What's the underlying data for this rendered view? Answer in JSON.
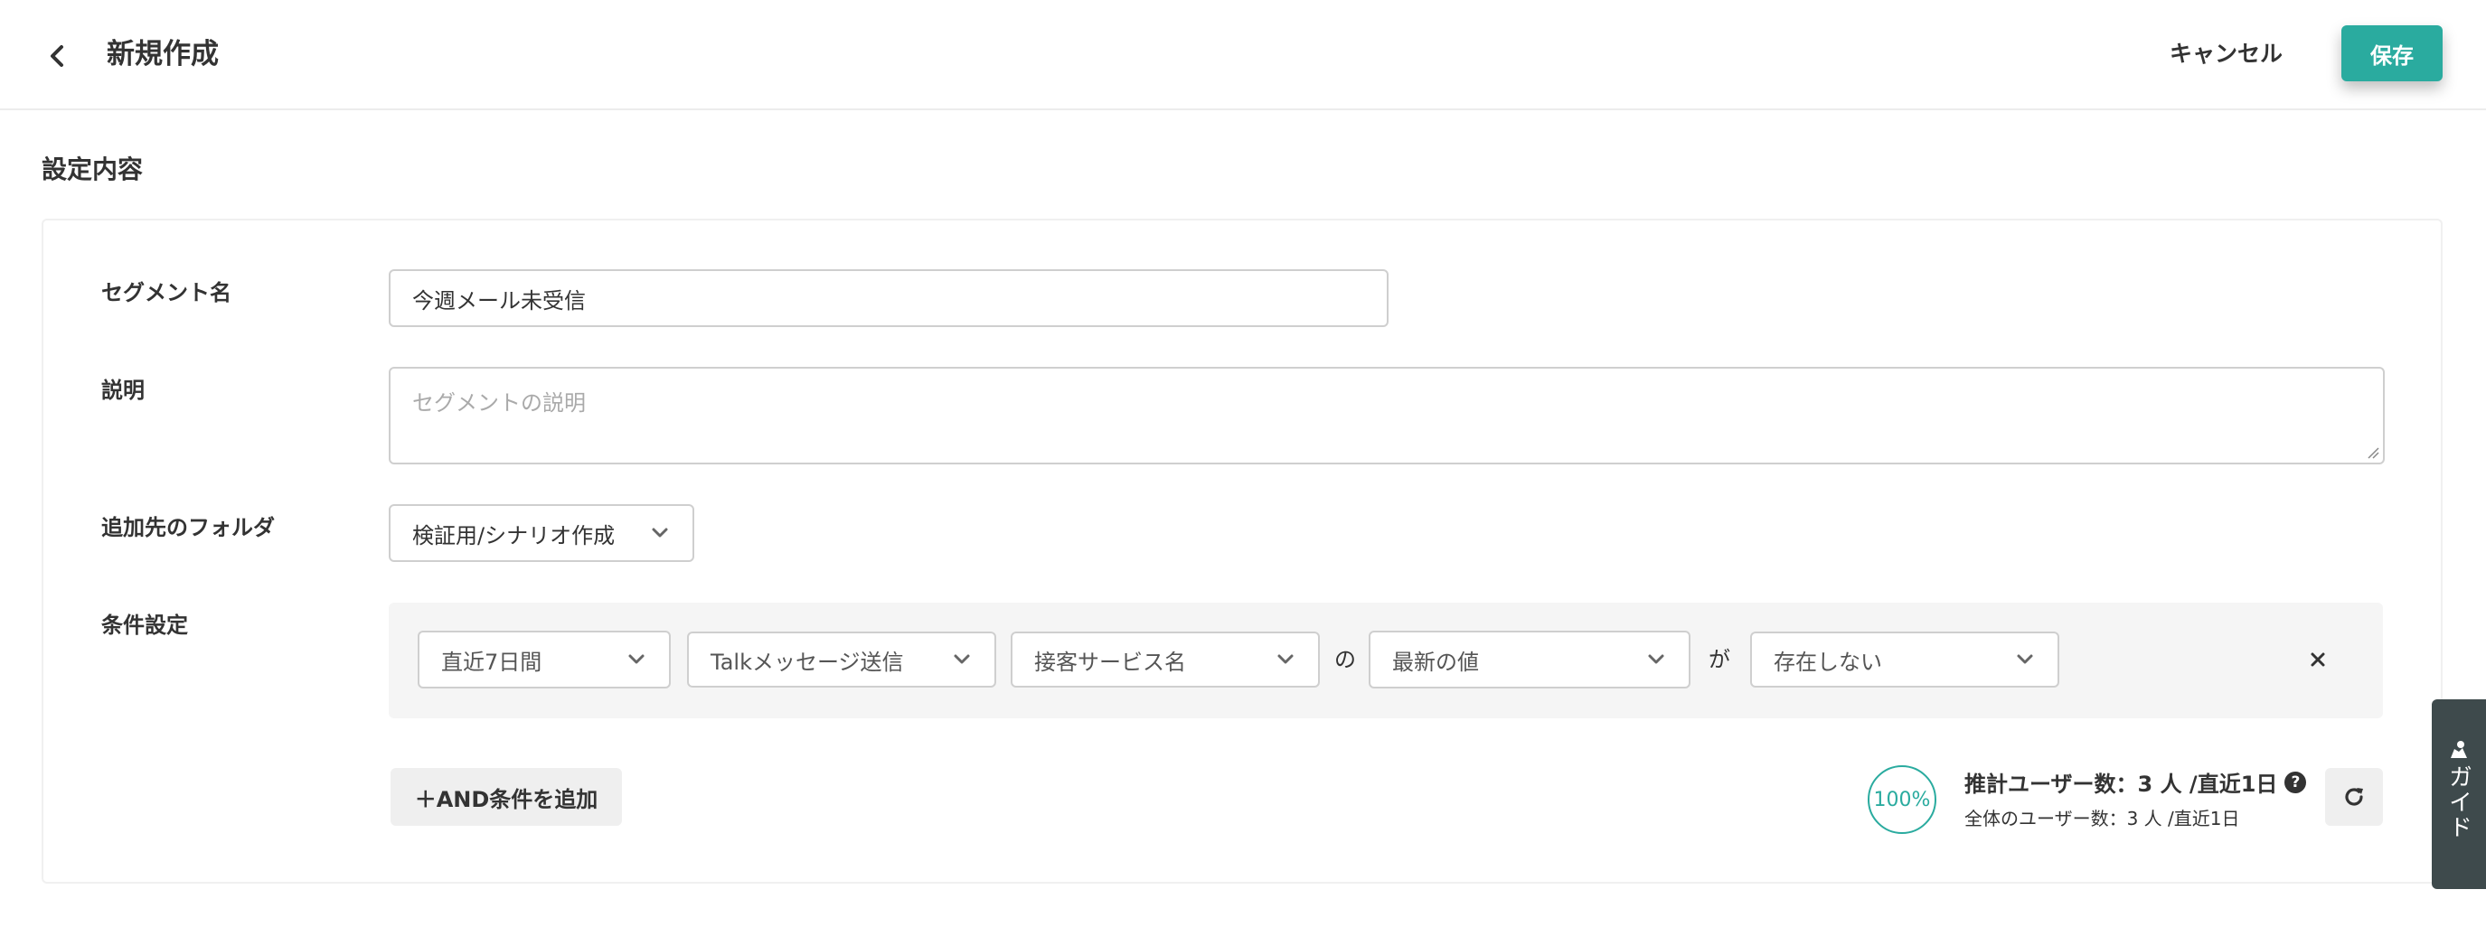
{
  "header": {
    "title": "新規作成",
    "cancel_label": "キャンセル",
    "save_label": "保存"
  },
  "section": {
    "title": "設定内容"
  },
  "form": {
    "segment_name": {
      "label": "セグメント名",
      "value": "今週メール未受信"
    },
    "description": {
      "label": "説明",
      "placeholder": "セグメントの説明"
    },
    "folder": {
      "label": "追加先のフォルダ",
      "value": "検証用/シナリオ作成"
    },
    "conditions": {
      "label": "条件設定",
      "period": "直近7日間",
      "event": "Talkメッセージ送信",
      "attribute": "接客サービス名",
      "joiner_no": "の",
      "value_type": "最新の値",
      "joiner_ga": "が",
      "operator": "存在しない"
    },
    "add_and_label": "＋AND条件を追加"
  },
  "estimate": {
    "ratio": "100%",
    "main": "推計ユーザー数：3 人 /直近1日",
    "sub": "全体のユーザー数：3 人 /直近1日"
  },
  "guide": {
    "label": "ガイド"
  },
  "colors": {
    "accent": "#2aab9f",
    "guide_bg": "#3e4a4c"
  }
}
